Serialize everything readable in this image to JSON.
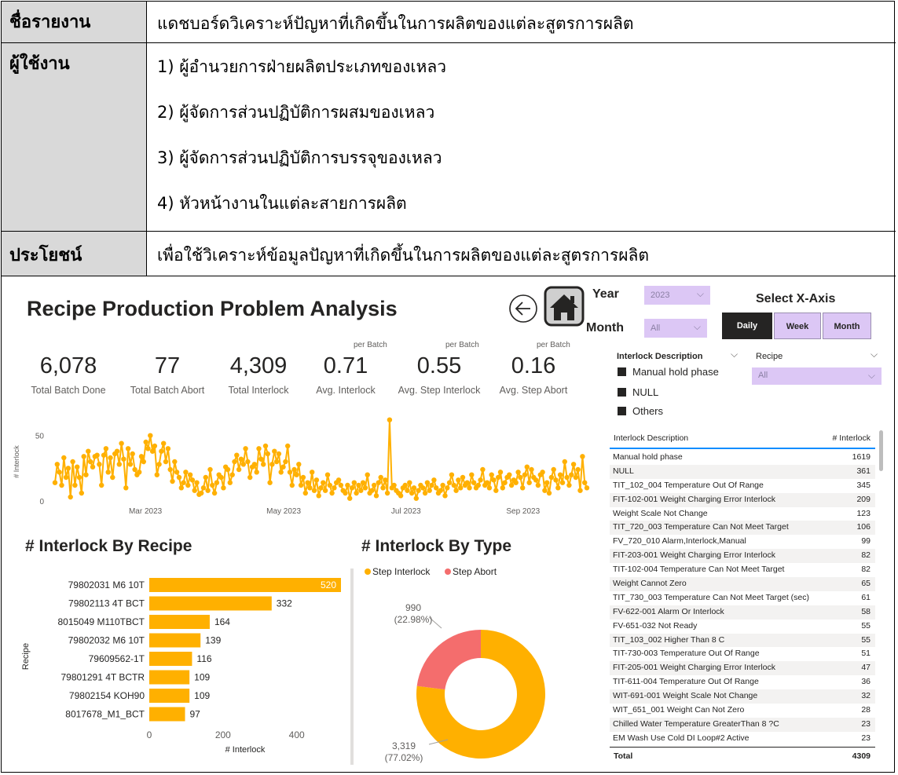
{
  "info": {
    "report_name_label": "ชื่อรายงาน",
    "report_name_value": "แดชบอร์ดวิเคราะห์ปัญหาที่เกิดขึ้นในการผลิตของแต่ละสูตรการผลิต",
    "users_label": "ผู้ใช้งาน",
    "users": [
      "1) ผู้อำนวยการฝ่ายผลิตประเภทของเหลว",
      "2) ผู้จัดการส่วนปฏิบัติการผสมของเหลว",
      "3) ผู้จัดการส่วนปฏิบัติการบรรจุของเหลว",
      "4) หัวหน้างานในแต่ละสายการผลิต"
    ],
    "benefit_label": "ประโยชน์",
    "benefit_value": "เพื่อใช้วิเคราะห์ข้อมูลปัญหาที่เกิดขึ้นในการผลิตของแต่ละสูตรการผลิต"
  },
  "dashboard": {
    "title": "Recipe Production Problem Analysis",
    "back_icon": "back-arrow-icon",
    "home_icon": "home-icon",
    "year_label": "Year",
    "year_value": "2023",
    "month_label": "Month",
    "month_value": "All",
    "select_x_label": "Select X-Axis",
    "x_buttons": [
      "Daily",
      "Week",
      "Month"
    ],
    "kpis": [
      {
        "value": "6,078",
        "label": "Total Batch Done",
        "sup": ""
      },
      {
        "value": "77",
        "label": "Total Batch Abort",
        "sup": ""
      },
      {
        "value": "4,309",
        "label": "Total Interlock",
        "sup": ""
      },
      {
        "value": "0.71",
        "label": "Avg. Interlock",
        "sup": "per Batch"
      },
      {
        "value": "0.55",
        "label": "Avg. Step Interlock",
        "sup": "per Batch"
      },
      {
        "value": "0.16",
        "label": "Avg. Step Abort",
        "sup": "per Batch"
      }
    ],
    "filter_interlock_label": "Interlock Description",
    "filter_interlock_items": [
      "Manual hold phase",
      "NULL",
      "Others"
    ],
    "filter_recipe_label": "Recipe",
    "filter_recipe_value": "All",
    "colors": {
      "accent": "#ffb000",
      "abort": "#f46d6d",
      "slicer": "#dcc7f5",
      "button_active": "#252423"
    }
  },
  "table": {
    "col_desc": "Interlock Description",
    "col_count": "# Interlock",
    "rows": [
      [
        "Manual hold phase",
        "1619"
      ],
      [
        "NULL",
        "361"
      ],
      [
        "TIT_102_004 Temperature Out Of Range",
        "345"
      ],
      [
        "FIT-102-001 Weight Charging Error Interlock",
        "209"
      ],
      [
        "Weight Scale Not Change",
        "123"
      ],
      [
        "TIT_720_003 Temperature Can Not Meet Target",
        "106"
      ],
      [
        "FV_720_010 Alarm,Interlock,Manual",
        "99"
      ],
      [
        "FIT-203-001 Weight Charging Error Interlock",
        "82"
      ],
      [
        "TIT-102-004 Temperature Can Not Meet Target",
        "82"
      ],
      [
        "Weight Cannot Zero",
        "65"
      ],
      [
        "TIT_730_003 Temperature Can Not Meet Target (sec)",
        "61"
      ],
      [
        "FV-622-001 Alarm Or Interlock",
        "58"
      ],
      [
        "FV-651-032 Not Ready",
        "55"
      ],
      [
        "TIT_103_002 Higher Than 8 C",
        "55"
      ],
      [
        "TIT-730-003 Temperature Out Of Range",
        "51"
      ],
      [
        "FIT-205-001 Weight Charging Error Interlock",
        "47"
      ],
      [
        "TIT-611-004 Temperature Out Of Range",
        "36"
      ],
      [
        "WIT-691-001 Weight Scale Not Change",
        "32"
      ],
      [
        "WIT_651_001 Weight Can Not Zero",
        "28"
      ],
      [
        "Chilled Water Temperature GreaterThan 8 ?C",
        "23"
      ],
      [
        "EM Wash Use Cold DI Loop#2 Active",
        "23"
      ]
    ],
    "total_label": "Total",
    "total_value": "4309"
  },
  "chart_data": [
    {
      "type": "line",
      "ylabel": "# Interlock",
      "x_ticks": [
        "Mar 2023",
        "May 2023",
        "Jul 2023",
        "Sep 2023"
      ],
      "y_ticks": [
        "0",
        "50"
      ],
      "ylim": [
        0,
        60
      ],
      "values": [
        14,
        28,
        22,
        12,
        33,
        18,
        25,
        3,
        30,
        12,
        26,
        18,
        6,
        34,
        20,
        38,
        30,
        26,
        34,
        35,
        28,
        12,
        35,
        40,
        22,
        33,
        18,
        36,
        38,
        28,
        44,
        32,
        10,
        40,
        28,
        36,
        24,
        20,
        22,
        34,
        30,
        45,
        40,
        50,
        38,
        42,
        20,
        28,
        38,
        44,
        30,
        40,
        24,
        15,
        30,
        22,
        18,
        10,
        14,
        22,
        12,
        20,
        16,
        8,
        14,
        5,
        6,
        10,
        18,
        8,
        24,
        12,
        6,
        14,
        20,
        18,
        10,
        26,
        24,
        14,
        20,
        30,
        35,
        24,
        32,
        28,
        40,
        30,
        18,
        26,
        28,
        22,
        40,
        32,
        28,
        42,
        36,
        14,
        28,
        38,
        30,
        36,
        22,
        26,
        30,
        42,
        22,
        12,
        24,
        20,
        28,
        12,
        18,
        6,
        14,
        10,
        22,
        8,
        16,
        4,
        10,
        14,
        8,
        20,
        12,
        6,
        10,
        14,
        16,
        12,
        8,
        6,
        12,
        2,
        10,
        14,
        6,
        12,
        8,
        14,
        10,
        20,
        6,
        8,
        12,
        4,
        14,
        18,
        10,
        16,
        6,
        62,
        10,
        12,
        8,
        6,
        4,
        10,
        12,
        8,
        14,
        6,
        10,
        2,
        8,
        12,
        10,
        6,
        14,
        8,
        12,
        16,
        10,
        6,
        8,
        12,
        4,
        10,
        14,
        20,
        12,
        8,
        16,
        10,
        18,
        12,
        14,
        10,
        20,
        14,
        10,
        12,
        16,
        24,
        12,
        14,
        10,
        20,
        16,
        8,
        18,
        22,
        10,
        14,
        18,
        20,
        12,
        16,
        14,
        22,
        18,
        10,
        20,
        26,
        14,
        24,
        18,
        16,
        12,
        20,
        22,
        8,
        14,
        6,
        18,
        24,
        16,
        10,
        20,
        14,
        30,
        18,
        12,
        20,
        28,
        18,
        24,
        8,
        34,
        14,
        10
      ]
    },
    {
      "type": "bar",
      "title": "# Interlock By Recipe",
      "xlabel": "# Interlock",
      "ylabel": "Recipe",
      "categories": [
        "79802031 M6 10T",
        "79802113 4T BCT",
        "8015049 M110TBCT",
        "79802032 M6 10T",
        "79609562-1T",
        "79801291 4T BCTR",
        "79802154 KOH90",
        "8017678_M1_BCT"
      ],
      "values": [
        520,
        332,
        164,
        139,
        116,
        109,
        109,
        97
      ],
      "x_ticks": [
        "0",
        "200",
        "400"
      ],
      "xlim": [
        0,
        520
      ]
    },
    {
      "type": "pie",
      "title": "# Interlock By Type",
      "series": [
        {
          "name": "Step Interlock",
          "value": 3319,
          "label": "3,319",
          "pct": "(77.02%)"
        },
        {
          "name": "Step Abort",
          "value": 990,
          "label": "990",
          "pct": "(22.98%)"
        }
      ]
    }
  ]
}
